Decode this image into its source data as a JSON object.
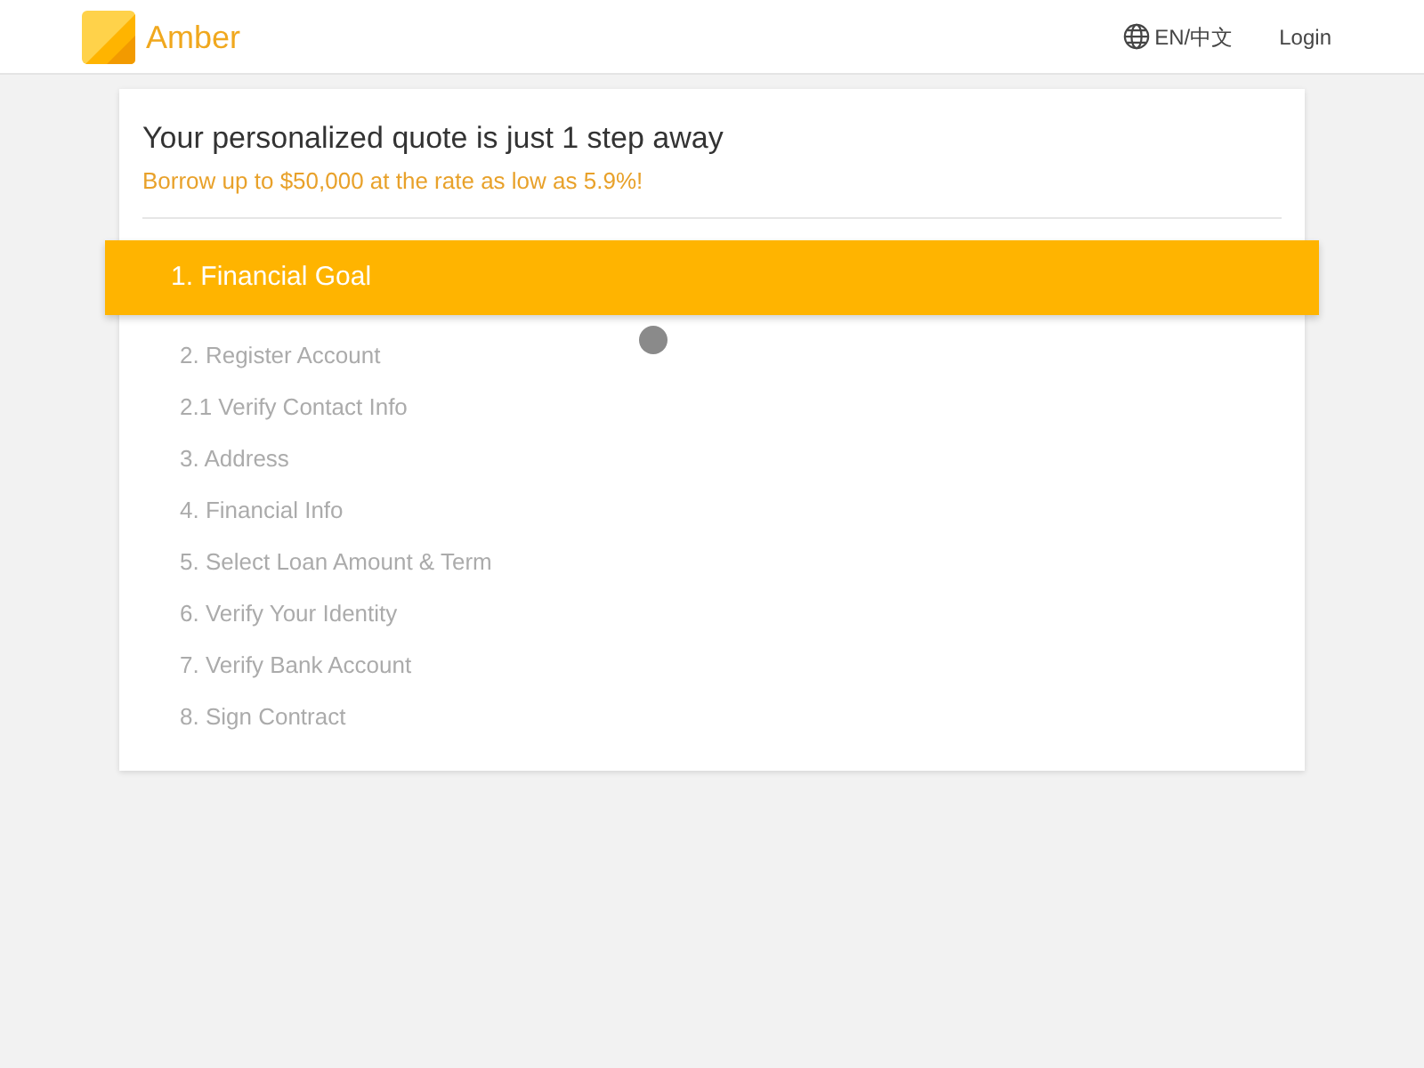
{
  "header": {
    "brand": "Amber",
    "language": "EN/中文",
    "login": "Login"
  },
  "quote": {
    "title": "Your personalized quote is just 1 step away",
    "subtitle": "Borrow up to $50,000 at the rate as low as 5.9%!"
  },
  "steps": [
    {
      "label": "1. Financial Goal",
      "selected": true
    },
    {
      "label": "2. Register Account",
      "selected": false
    },
    {
      "label": "2.1 Verify Contact Info",
      "selected": false
    },
    {
      "label": "3. Address",
      "selected": false
    },
    {
      "label": "4. Financial Info",
      "selected": false
    },
    {
      "label": "5. Select Loan Amount & Term",
      "selected": false
    },
    {
      "label": "6. Verify Your Identity",
      "selected": false
    },
    {
      "label": "7. Verify Bank Account",
      "selected": false
    },
    {
      "label": "8. Sign Contract",
      "selected": false
    }
  ]
}
